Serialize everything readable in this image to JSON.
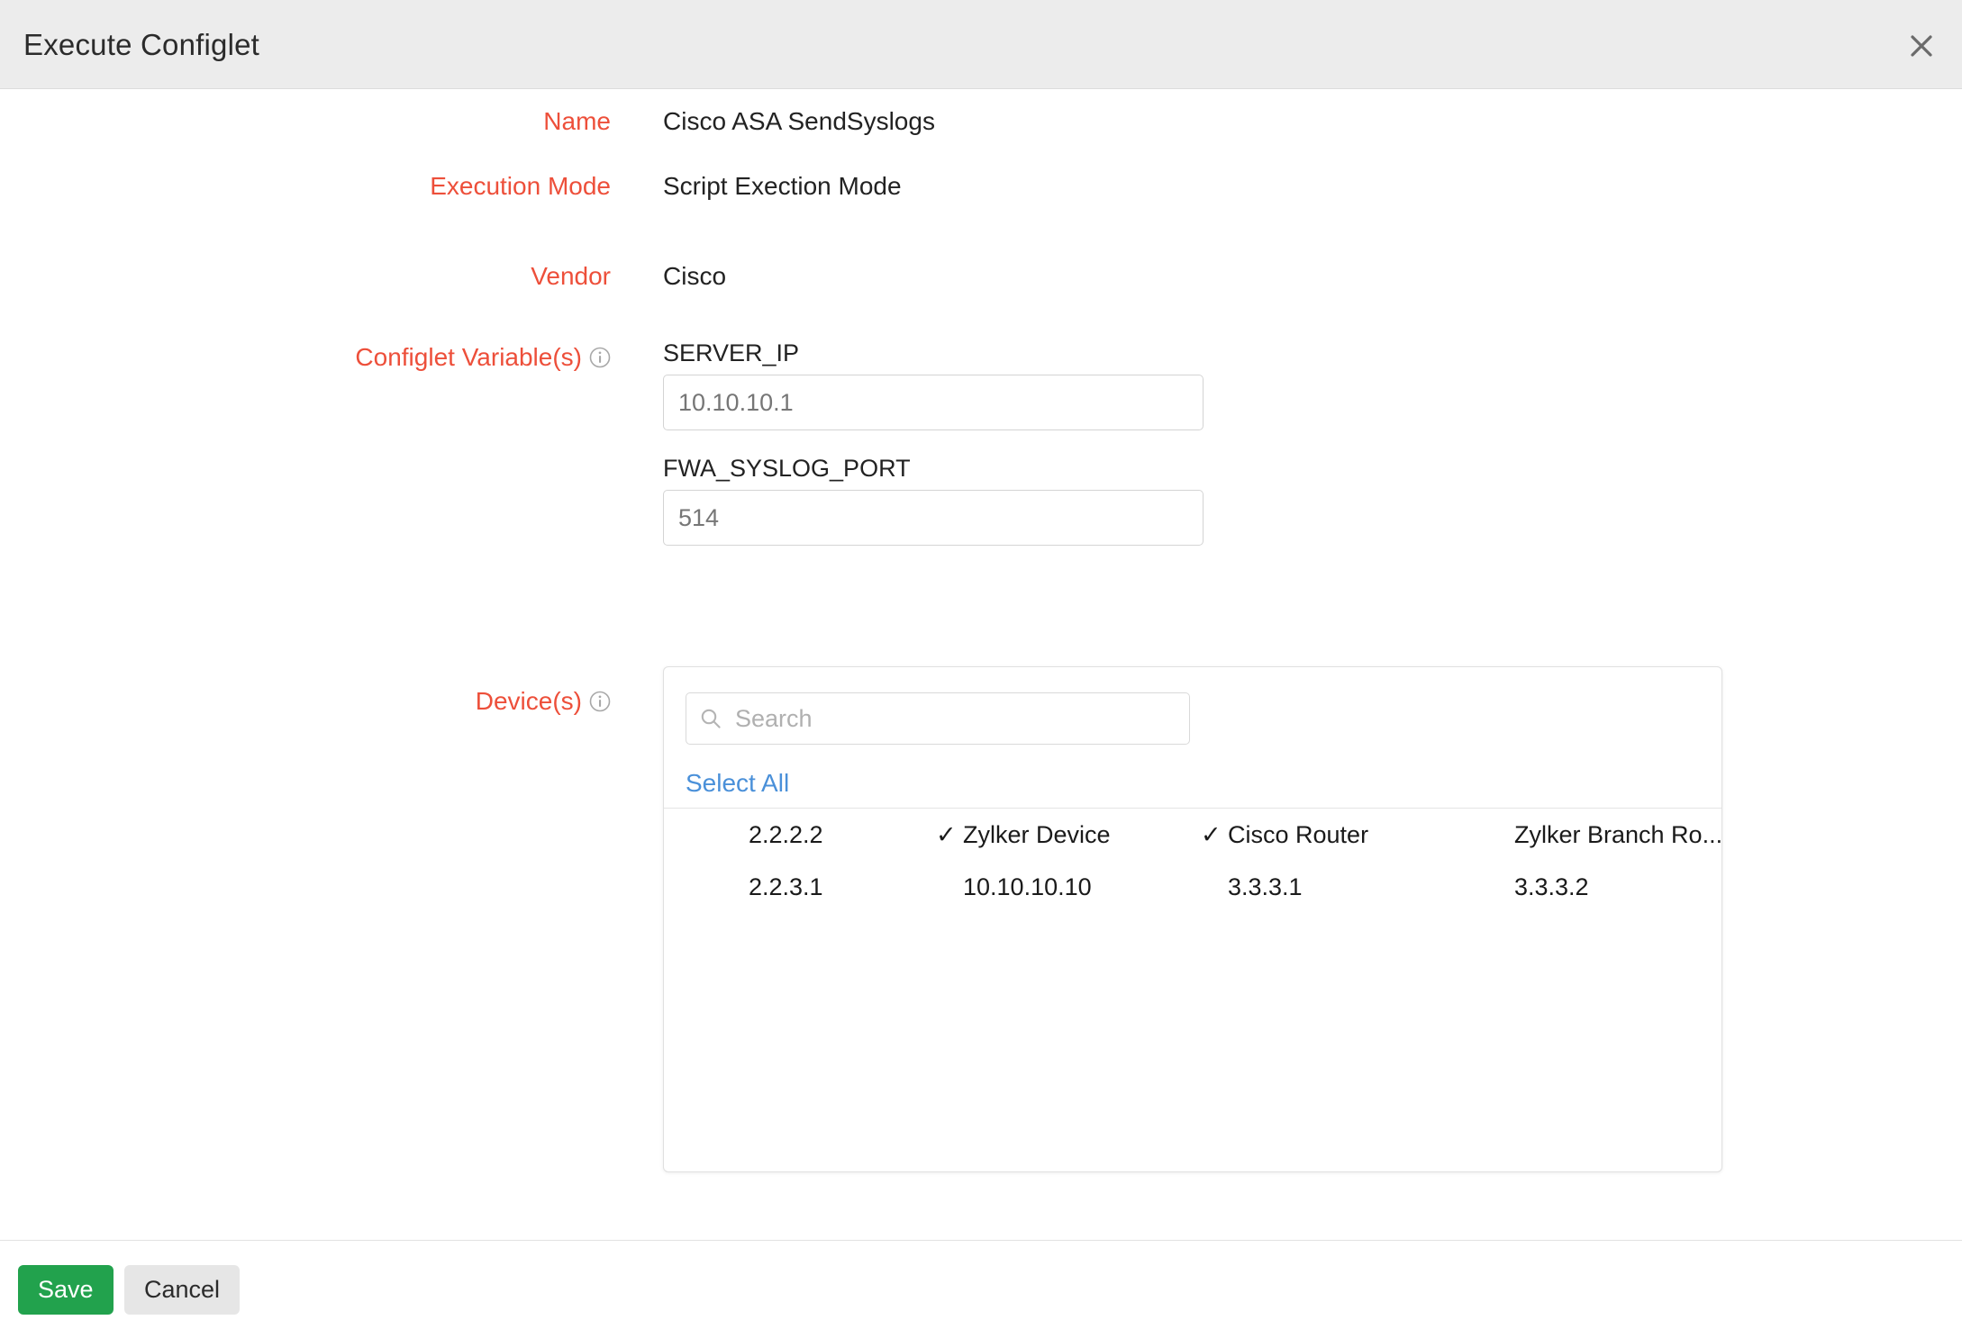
{
  "dialog": {
    "title": "Execute Configlet",
    "close_icon": "close-icon"
  },
  "form": {
    "name": {
      "label": "Name",
      "value": "Cisco ASA SendSyslogs"
    },
    "execution_mode": {
      "label": "Execution Mode",
      "value": "Script Exection Mode"
    },
    "vendor": {
      "label": "Vendor",
      "value": "Cisco"
    },
    "configlet_variables": {
      "label": "Configlet Variable(s)",
      "info_icon": "info-icon",
      "variables": [
        {
          "name": "SERVER_IP",
          "value": "10.10.10.1"
        },
        {
          "name": "FWA_SYSLOG_PORT",
          "value": "514"
        }
      ]
    },
    "devices": {
      "label": "Device(s)",
      "info_icon": "info-icon",
      "search": {
        "placeholder": "Search",
        "value": "",
        "icon": "search-icon"
      },
      "select_all_label": "Select All",
      "check_glyph": "✓",
      "rows": [
        [
          {
            "label": "2.2.2.2",
            "checked": false
          },
          {
            "label": "Zylker Device",
            "checked": true
          },
          {
            "label": "Cisco Router",
            "checked": true
          },
          {
            "label": "Zylker Branch Ro...",
            "checked": false
          }
        ],
        [
          {
            "label": "2.2.3.1",
            "checked": false
          },
          {
            "label": "10.10.10.10",
            "checked": false
          },
          {
            "label": "3.3.3.1",
            "checked": false
          },
          {
            "label": "3.3.3.2",
            "checked": false
          }
        ]
      ]
    }
  },
  "footer": {
    "save_label": "Save",
    "cancel_label": "Cancel"
  },
  "colors": {
    "label_accent": "#ed4f3a",
    "link": "#4a90d9",
    "save_bg": "#22a24d",
    "cancel_bg": "#e6e6e6",
    "header_bg": "#ececec"
  }
}
